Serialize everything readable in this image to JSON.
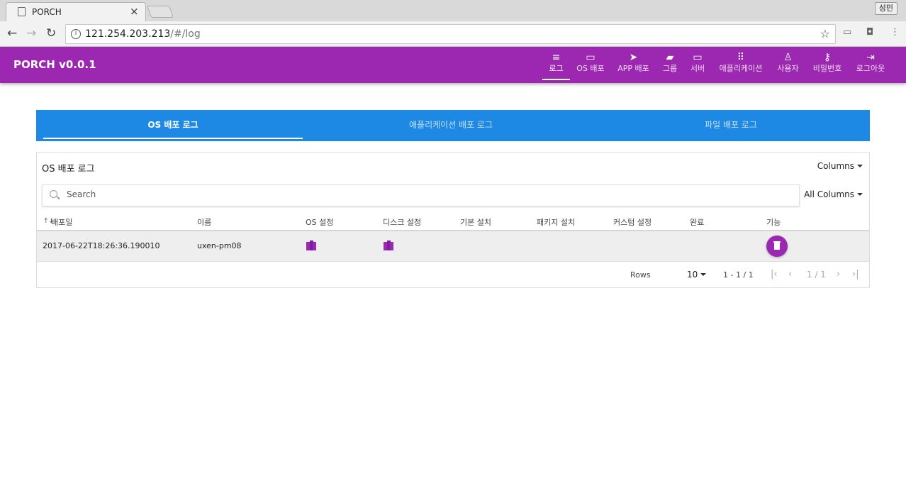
{
  "browser": {
    "tab_title": "PORCH",
    "profile_name": "성민",
    "url_host": "121.254.203.213",
    "url_path": "/#/log"
  },
  "appbar": {
    "brand": "PORCH v0.0.1",
    "nav": [
      {
        "icon": "list-icon",
        "label": "로그"
      },
      {
        "icon": "cast-icon",
        "label": "OS 배포"
      },
      {
        "icon": "send-icon",
        "label": "APP 배포"
      },
      {
        "icon": "folder-add-icon",
        "label": "그룹"
      },
      {
        "icon": "laptop-icon",
        "label": "서버"
      },
      {
        "icon": "apps-grid-icon",
        "label": "애플리케이션"
      },
      {
        "icon": "person-icon",
        "label": "사용자"
      },
      {
        "icon": "key-icon",
        "label": "비밀번호"
      },
      {
        "icon": "logout-icon",
        "label": "로그아웃"
      }
    ],
    "color": "#9c27b0"
  },
  "tabs": {
    "items": [
      "OS 배포 로그",
      "애플리케이션 배포 로그",
      "파일 배포 로그"
    ],
    "active": 0,
    "color": "#1e88e5"
  },
  "table": {
    "title": "OS 배포 로그",
    "columns_label": "Columns",
    "search_placeholder": "Search",
    "all_columns_label": "All Columns",
    "sort_indicator": "↑↓",
    "headers": [
      "배포일",
      "이름",
      "OS 설정",
      "디스크 설정",
      "기본 설치",
      "패키지 설치",
      "커스텀 설정",
      "완료",
      "기능"
    ],
    "rows": [
      {
        "date": "2017-06-22T18:26:36.190010",
        "name": "uxen-pm08"
      }
    ],
    "footer": {
      "rows_label": "Rows",
      "rows_per_page": "10",
      "range": "1 - 1 / 1",
      "page": "1 / 1"
    }
  }
}
